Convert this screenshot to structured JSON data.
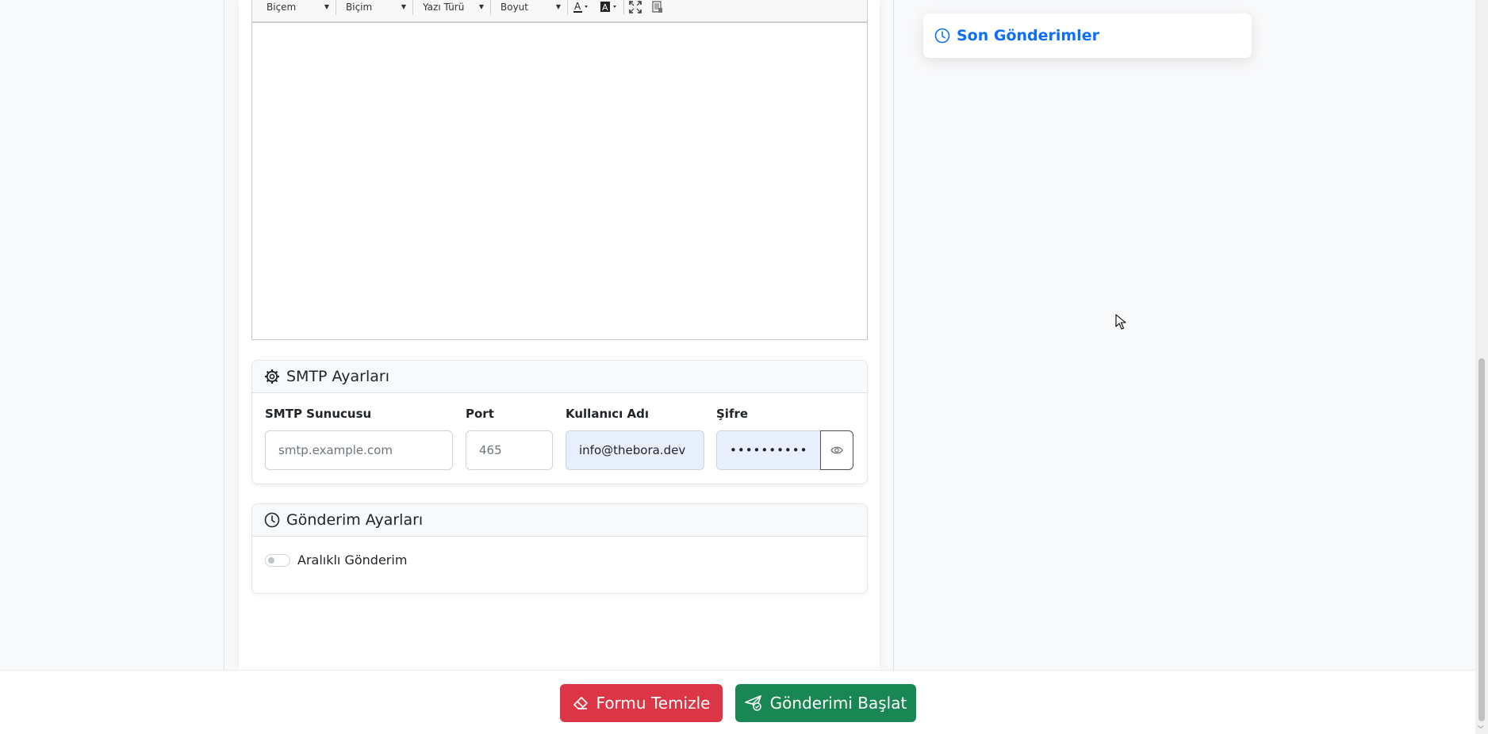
{
  "editor": {
    "toolbar": {
      "style_combo": "Biçem",
      "format_combo": "Biçim",
      "font_combo": "Yazı Türü",
      "size_combo": "Boyut"
    }
  },
  "smtp_section": {
    "title": "SMTP Ayarları",
    "server_label": "SMTP Sunucusu",
    "server_placeholder": "smtp.example.com",
    "port_label": "Port",
    "port_placeholder": "465",
    "username_label": "Kullanıcı Adı",
    "username_value": "info@thebora.dev",
    "password_label": "Şifre",
    "password_value": "••••••••••"
  },
  "sending_section": {
    "title": "Gönderim Ayarları",
    "interval_toggle_label": "Aralıklı Gönderim",
    "interval_enabled": false
  },
  "recent_panel": {
    "title": "Son Gönderimler"
  },
  "footer": {
    "clear_button": "Formu Temizle",
    "start_button": "Gönderimi Başlat"
  },
  "colors": {
    "primary": "#0d6efd",
    "danger": "#dc3545",
    "success": "#198754",
    "autofill": "#e8f0fe"
  }
}
